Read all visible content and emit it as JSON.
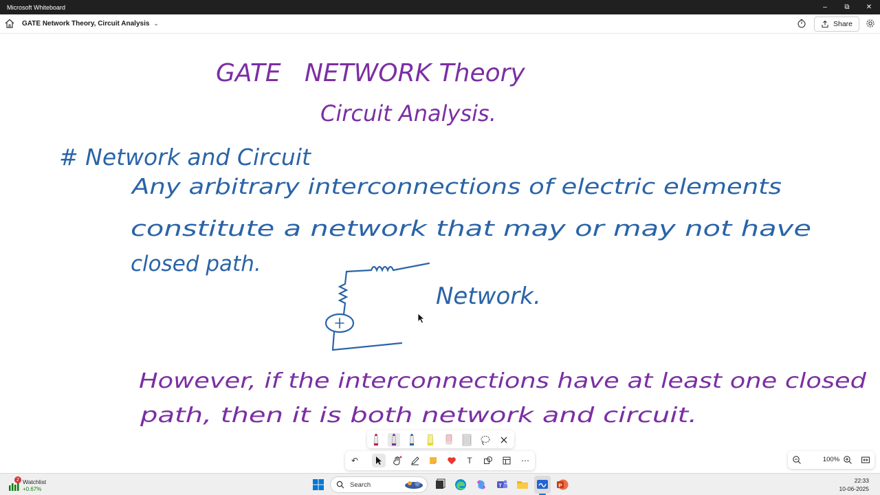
{
  "window": {
    "app_title": "Microsoft Whiteboard",
    "minimize_icon": "minimize-icon",
    "restore_icon": "restore-icon",
    "close_icon": "close-icon"
  },
  "header": {
    "board_title": "GATE Network Theory, Circuit Analysis",
    "share_label": "Share"
  },
  "ink": {
    "title_line1": "GATE   NETWORK Theory",
    "title_line2": "Circuit Analysis.",
    "heading": "# Network and Circuit",
    "para1_line1": "Any arbitrary interconnections of electric elements",
    "para1_line2": "constitute a network that may or may not have",
    "para1_line3": "closed path.",
    "diagram_label": "Network.",
    "para2_line1": "However, if the interconnections have at least one closed",
    "para2_line2": "path, then it is both network and circuit.",
    "colors": {
      "purple": "#7b2fa3",
      "blue": "#2a64a8"
    }
  },
  "tools": {
    "pens": [
      "pink-pen-icon",
      "purple-pen-icon",
      "blue-pen-icon",
      "yellow-highlighter-icon",
      "eraser-icon",
      "ruler-icon",
      "lasso-icon",
      "close-tray-icon"
    ],
    "row": [
      "undo-icon",
      "select-icon",
      "hand-icon",
      "pen-icon",
      "sticky-note-icon",
      "reactions-icon",
      "text-icon",
      "shapes-icon",
      "templates-icon",
      "more-icon"
    ]
  },
  "zoom": {
    "value": "100%"
  },
  "taskbar": {
    "watchlist_label": "Watchlist",
    "watchlist_change": "+0.67%",
    "watchlist_badge": "2",
    "search_placeholder": "Search",
    "time": "22:33",
    "date": "10-06-2025"
  }
}
